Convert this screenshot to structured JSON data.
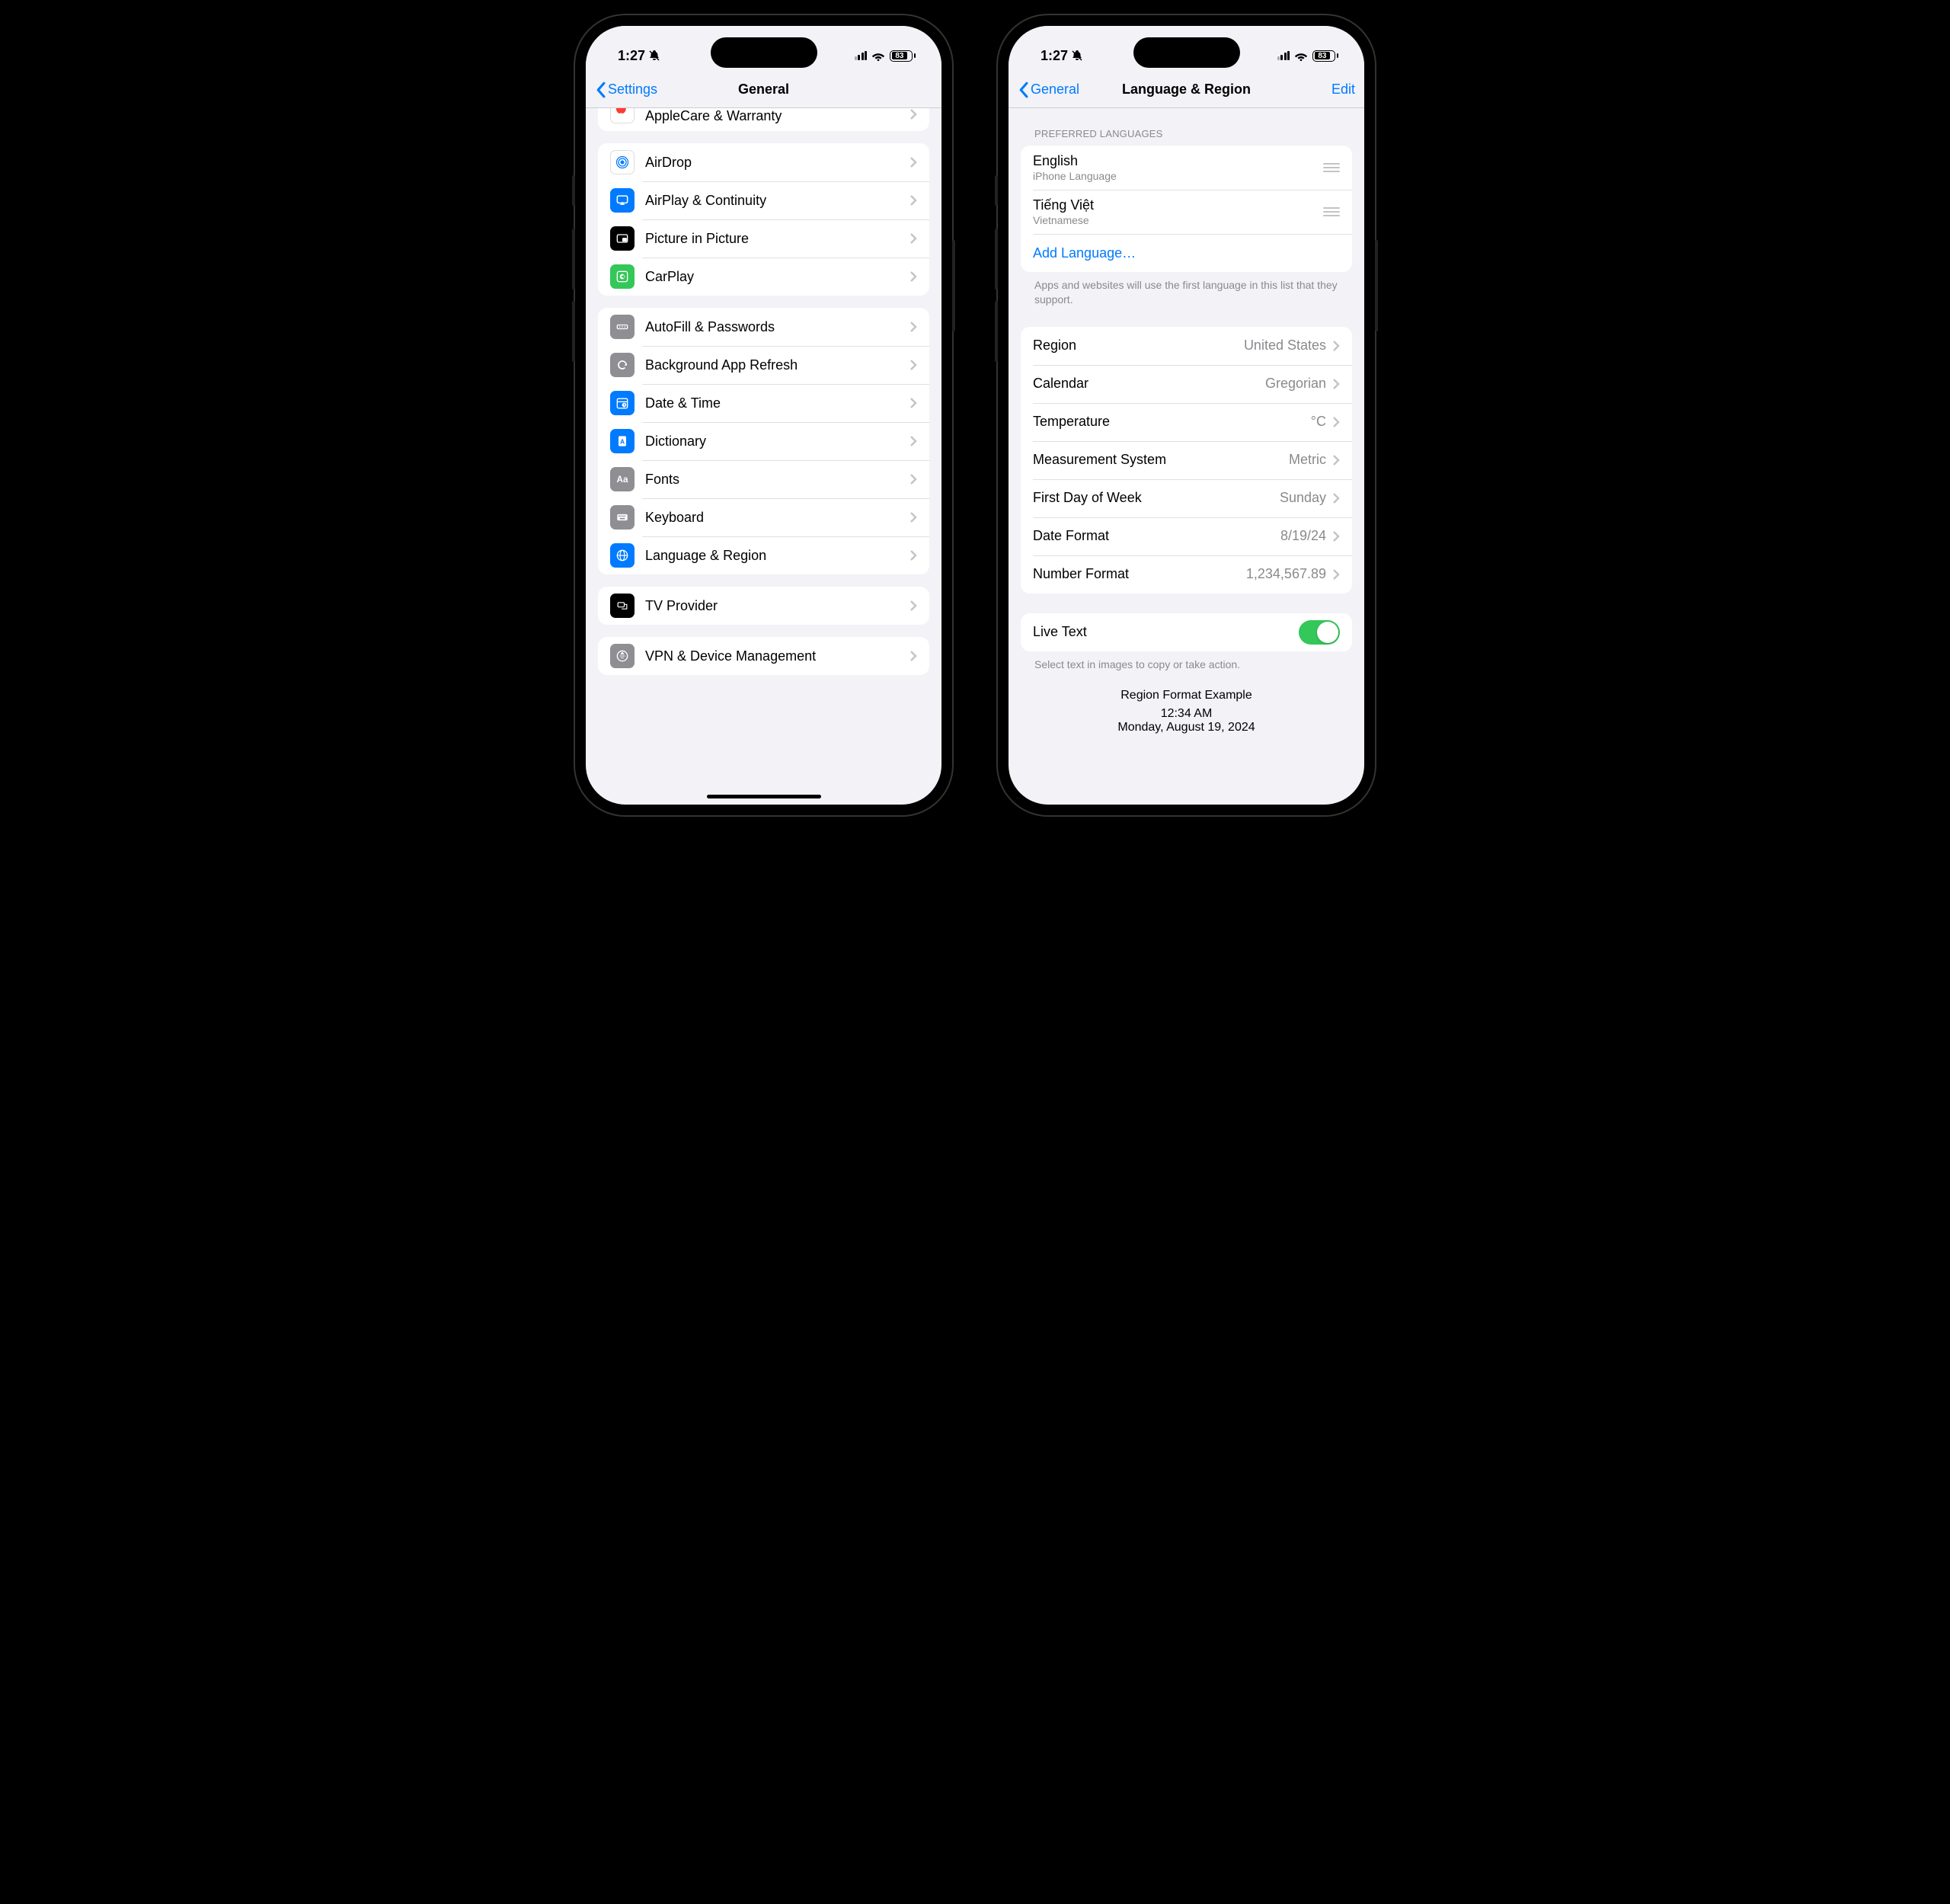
{
  "status": {
    "time": "1:27",
    "battery": "83"
  },
  "phone1": {
    "back": "Settings",
    "title": "General",
    "rows": {
      "applecare": "AppleCare & Warranty",
      "airdrop": "AirDrop",
      "airplay": "AirPlay & Continuity",
      "pip": "Picture in Picture",
      "carplay": "CarPlay",
      "autofill": "AutoFill & Passwords",
      "bgrefresh": "Background App Refresh",
      "datetime": "Date & Time",
      "dictionary": "Dictionary",
      "fonts": "Fonts",
      "keyboard": "Keyboard",
      "langregion": "Language & Region",
      "tvprovider": "TV Provider",
      "vpn": "VPN & Device Management"
    }
  },
  "phone2": {
    "back": "General",
    "title": "Language & Region",
    "edit": "Edit",
    "section_preferred": "Preferred Languages",
    "languages": [
      {
        "name": "English",
        "sub": "iPhone Language"
      },
      {
        "name": "Tiếng Việt",
        "sub": "Vietnamese"
      }
    ],
    "add_language": "Add Language…",
    "footer_langs": "Apps and websites will use the first language in this list that they support.",
    "region": {
      "label": "Region",
      "value": "United States"
    },
    "calendar": {
      "label": "Calendar",
      "value": "Gregorian"
    },
    "temperature": {
      "label": "Temperature",
      "value": "°C"
    },
    "measurement": {
      "label": "Measurement System",
      "value": "Metric"
    },
    "firstday": {
      "label": "First Day of Week",
      "value": "Sunday"
    },
    "dateformat": {
      "label": "Date Format",
      "value": "8/19/24"
    },
    "numberformat": {
      "label": "Number Format",
      "value": "1,234,567.89"
    },
    "livetext": {
      "label": "Live Text"
    },
    "livetext_footer": "Select text in images to copy or take action.",
    "example": {
      "title": "Region Format Example",
      "time": "12:34 AM",
      "date": "Monday, August 19, 2024"
    }
  }
}
